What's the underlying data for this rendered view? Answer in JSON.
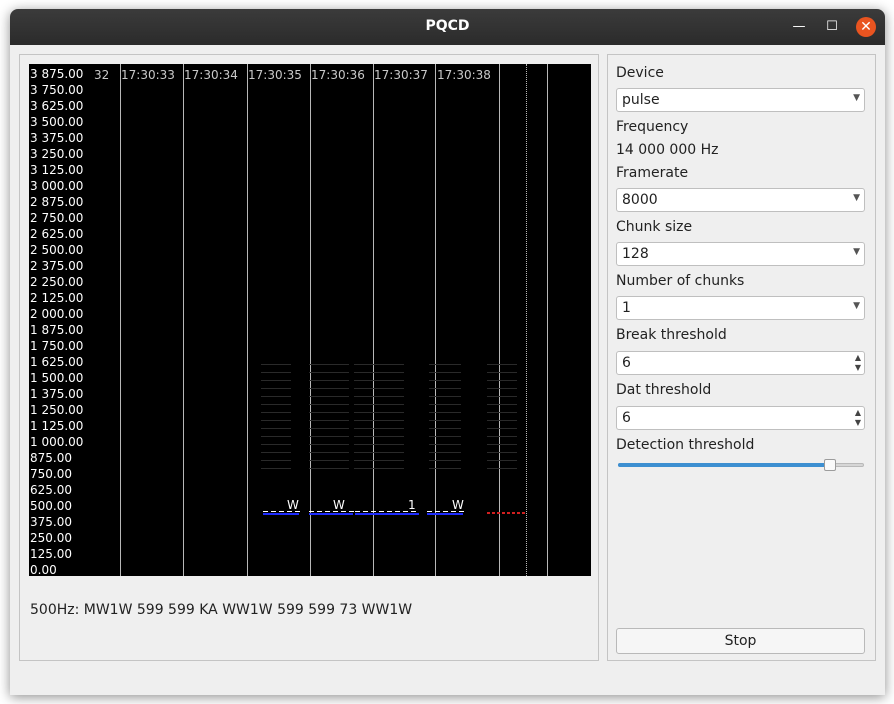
{
  "window": {
    "title": "PQCD",
    "minimize": "—",
    "maximize": "☐",
    "close": "✕"
  },
  "waterfall": {
    "y_labels": [
      "3 875.00",
      "3 750.00",
      "3 625.00",
      "3 500.00",
      "3 375.00",
      "3 250.00",
      "3 125.00",
      "3 000.00",
      "2 875.00",
      "2 750.00",
      "2 625.00",
      "2 500.00",
      "2 375.00",
      "2 250.00",
      "2 125.00",
      "2 000.00",
      "1 875.00",
      "1 750.00",
      "1 625.00",
      "1 500.00",
      "1 375.00",
      "1 250.00",
      "1 125.00",
      "1 000.00",
      "875.00",
      "750.00",
      "625.00",
      "500.00",
      "375.00",
      "250.00",
      "125.00",
      "0.00"
    ],
    "time_labels": [
      "32",
      "17:30:33",
      "17:30:34",
      "17:30:35",
      "17:30:36",
      "17:30:37",
      "17:30:38"
    ],
    "cw_marks": [
      "W",
      "W",
      "1",
      "W"
    ]
  },
  "decoded_text": "500Hz:  MW1W 599 599 KA WW1W 599 599 73 WW1W",
  "controls": {
    "device": {
      "label": "Device",
      "value": "pulse"
    },
    "frequency": {
      "label": "Frequency",
      "value": "14 000 000 Hz"
    },
    "framerate": {
      "label": "Framerate",
      "value": "8000"
    },
    "chunk_size": {
      "label": "Chunk size",
      "value": "128"
    },
    "num_chunks": {
      "label": "Number of chunks",
      "value": "1"
    },
    "break_threshold": {
      "label": "Break threshold",
      "value": "6"
    },
    "dat_threshold": {
      "label": "Dat threshold",
      "value": "6"
    },
    "detection_threshold": {
      "label": "Detection threshold",
      "level": 0.86
    },
    "stop_label": "Stop"
  },
  "colors": {
    "accent": "#3d8fd1",
    "close": "#e95420",
    "trace": "#1e2cff"
  }
}
